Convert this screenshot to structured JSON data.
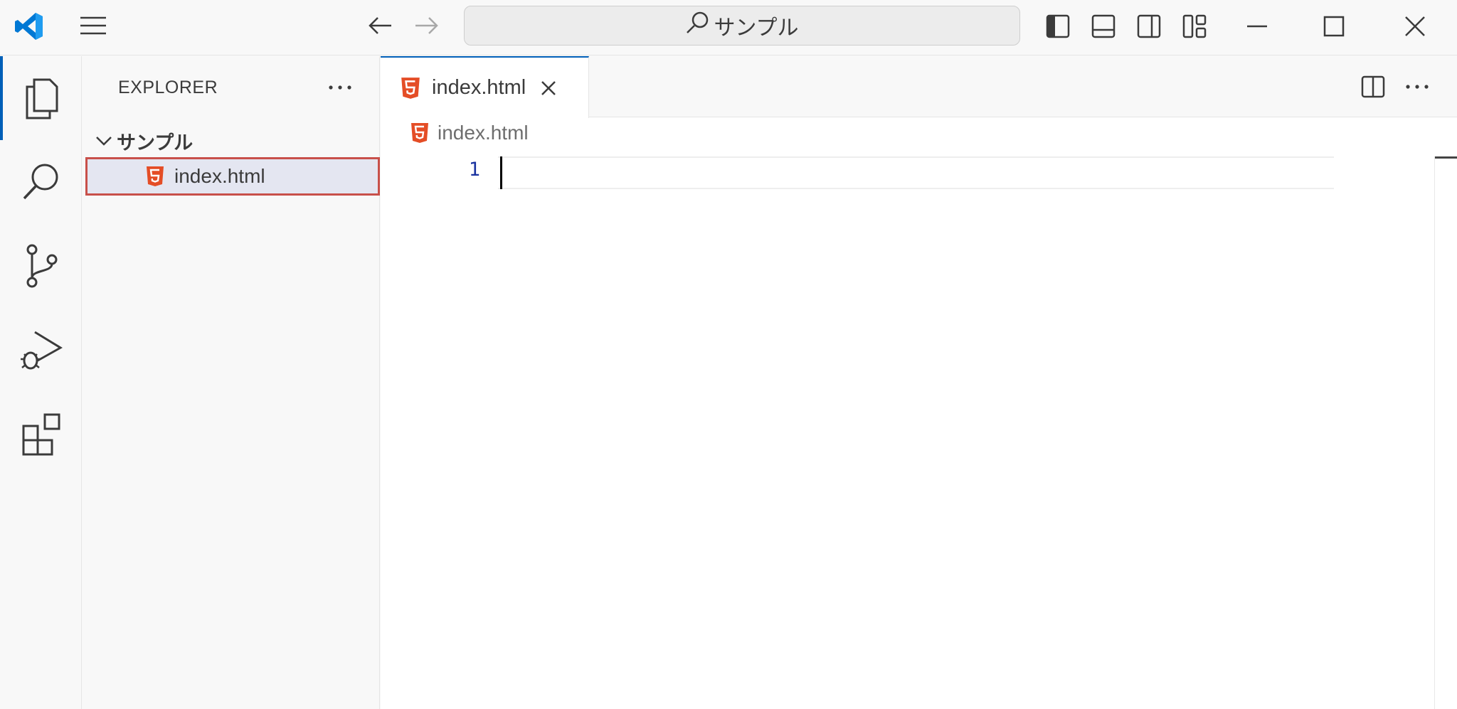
{
  "titlebar": {
    "app_icon": "vscode-logo-icon",
    "menu_icon": "hamburger-menu-icon",
    "back_icon": "arrow-left-icon",
    "forward_icon": "arrow-right-icon",
    "search_text": "サンプル",
    "layout_icons": [
      "toggle-primary-sidebar-icon",
      "toggle-panel-icon",
      "toggle-secondary-sidebar-icon",
      "customize-layout-icon"
    ],
    "window_controls": [
      "minimize-icon",
      "maximize-icon",
      "close-icon"
    ]
  },
  "activitybar": {
    "items": [
      "explorer-icon",
      "search-icon",
      "source-control-icon",
      "run-debug-icon",
      "extensions-icon"
    ],
    "active": "explorer-icon",
    "accent": "#005fb8"
  },
  "sidebar": {
    "title": "EXPLORER",
    "more_icon": "ellipsis-icon",
    "folder": "サンプル",
    "files": [
      {
        "name": "index.html",
        "icon": "html5-icon",
        "selected": true
      }
    ],
    "highlight_color": "#c8504a"
  },
  "editor": {
    "tab": {
      "label": "index.html",
      "icon": "html5-icon",
      "close_icon": "close-icon"
    },
    "actions": [
      "split-editor-icon",
      "ellipsis-icon"
    ],
    "breadcrumb": "index.html",
    "line_numbers": [
      "1"
    ],
    "html_icon_color": "#e44d26"
  }
}
